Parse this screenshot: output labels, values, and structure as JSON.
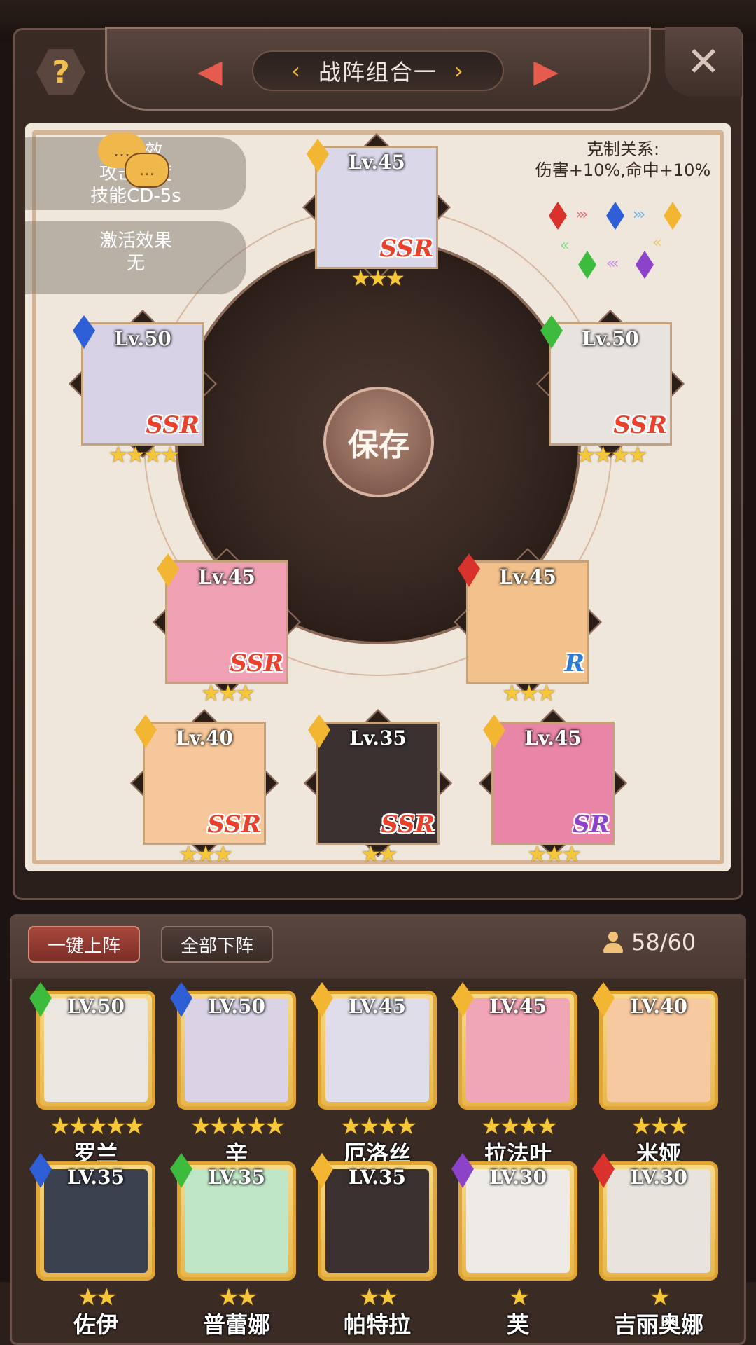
{
  "header": {
    "title": "战阵组合一",
    "help_glyph": "?",
    "close_glyph": "✕",
    "prev_glyph": "‹",
    "next_glyph": "›"
  },
  "effects": {
    "box1_line1": "激活效",
    "box1_line2": "攻击速度",
    "box1_line3": "技能CD-5s",
    "box2_line1": "激活效果",
    "box2_line2": "无"
  },
  "restraint": {
    "title": "克制关系:",
    "detail": "伤害+10%,命中+10%"
  },
  "save_label": "保存",
  "formation": [
    {
      "lv": "Lv.45",
      "rarity": "SSR",
      "rarity_color": "#e8412c",
      "element_color": "#f2b632",
      "stars": "★★★",
      "face": "#d9d7e8"
    },
    {
      "lv": "Lv.50",
      "rarity": "SSR",
      "rarity_color": "#e8412c",
      "element_color": "#2f5fd6",
      "stars": "★★★★",
      "face": "#d8d2e6"
    },
    {
      "lv": "Lv.50",
      "rarity": "SSR",
      "rarity_color": "#e8412c",
      "element_color": "#3dbb3d",
      "stars": "★★★★",
      "face": "#e9e3df"
    },
    {
      "lv": "Lv.45",
      "rarity": "SSR",
      "rarity_color": "#e8412c",
      "element_color": "#f2b632",
      "stars": "★★★",
      "face": "#f0a2b4"
    },
    {
      "lv": "Lv.45",
      "rarity": "R",
      "rarity_color": "#2e7bd6",
      "element_color": "#d9312c",
      "stars": "★★★",
      "face": "#f3c28c"
    },
    {
      "lv": "Lv.40",
      "rarity": "SSR",
      "rarity_color": "#e8412c",
      "element_color": "#f2b632",
      "stars": "★★★",
      "face": "#f5c79a"
    },
    {
      "lv": "Lv.35",
      "rarity": "SSR",
      "rarity_color": "#e8412c",
      "element_color": "#f2b632",
      "stars": "★★",
      "face": "#3a3030"
    },
    {
      "lv": "Lv.45",
      "rarity": "SR",
      "rarity_color": "#8d43c9",
      "element_color": "#f2b632",
      "stars": "★★★",
      "face": "#e986a8"
    }
  ],
  "bottom": {
    "deploy_all": "一键上阵",
    "remove_all": "全部下阵",
    "count": "58/60"
  },
  "heroes": [
    {
      "lv": "LV.50",
      "name": "罗兰",
      "stars": "★★★★★",
      "element_color": "#3dbb3d",
      "face": "#ece6e1"
    },
    {
      "lv": "LV.50",
      "name": "辛",
      "stars": "★★★★★",
      "element_color": "#2f5fd6",
      "face": "#dad3e6"
    },
    {
      "lv": "LV.45",
      "name": "厄洛丝",
      "stars": "★★★★",
      "element_color": "#f2b632",
      "face": "#dfdde9"
    },
    {
      "lv": "LV.45",
      "name": "拉法叶",
      "stars": "★★★★",
      "element_color": "#f2b632",
      "face": "#f1a6b7"
    },
    {
      "lv": "LV.40",
      "name": "米娅",
      "stars": "★★★",
      "element_color": "#f2b632",
      "face": "#f6c9a0"
    },
    {
      "lv": "LV.35",
      "name": "佐伊",
      "stars": "★★",
      "element_color": "#2f5fd6",
      "face": "#3c4150"
    },
    {
      "lv": "LV.35",
      "name": "普蕾娜",
      "stars": "★★",
      "element_color": "#3dbb3d",
      "face": "#bfe6c7"
    },
    {
      "lv": "LV.35",
      "name": "帕特拉",
      "stars": "★★",
      "element_color": "#f2b632",
      "face": "#3a3030"
    },
    {
      "lv": "LV.30",
      "name": "芙",
      "stars": "★",
      "element_color": "#8d43c9",
      "face": "#eeeae6"
    },
    {
      "lv": "LV.30",
      "name": "吉丽奥娜",
      "stars": "★",
      "element_color": "#d9312c",
      "face": "#e8e3dc"
    }
  ]
}
